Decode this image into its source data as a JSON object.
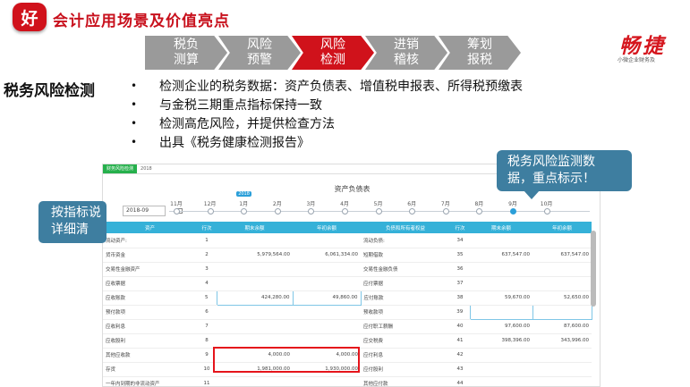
{
  "header": {
    "badge": "好",
    "title": "会计应用场景及价值亮点"
  },
  "brand": {
    "name": "畅捷",
    "subtitle": "小微企业财务及"
  },
  "steps": [
    {
      "label": "税负\n测算",
      "active": false,
      "color": "#9a9a9a"
    },
    {
      "label": "风险\n预警",
      "active": false,
      "color": "#9a9a9a"
    },
    {
      "label": "风险\n检测",
      "active": true,
      "color": "#d0121b"
    },
    {
      "label": "进销\n稽核",
      "active": false,
      "color": "#9a9a9a"
    },
    {
      "label": "筹划\n报税",
      "active": false,
      "color": "#9a9a9a"
    }
  ],
  "section": {
    "title": "税务风险检测",
    "bullets": [
      "检测企业的税务数据：资产负债表、增值税申报表、所得税预缴表",
      "与金税三期重点指标保持一致",
      "检测高危风险，并提供检查方法",
      "出具《税务健康检测报告》"
    ]
  },
  "screenshot": {
    "tab_active": "财务风险检测",
    "tab_other": "2018",
    "table_title": "资产负债表",
    "date_value": "2018-09",
    "timeline": {
      "year_tag": "2018",
      "months": [
        "11月",
        "12月",
        "1月",
        "2月",
        "3月",
        "4月",
        "5月",
        "6月",
        "7月",
        "8月",
        "9月",
        "10月"
      ],
      "selected_index": 10
    },
    "columns": [
      "资产",
      "行次",
      "期末余额",
      "年初余额",
      "负债和所有者权益",
      "行次",
      "期末余额",
      "年初余额"
    ],
    "rows": [
      [
        "流动资产:",
        "1",
        "",
        "",
        "流动负债:",
        "34",
        "",
        ""
      ],
      [
        "货币资金",
        "2",
        "5,979,564.00",
        "6,061,334.00",
        "短期借款",
        "35",
        "637,547.00",
        "637,547.00"
      ],
      [
        "交易性金融资产",
        "3",
        "",
        "",
        "交易性金融负债",
        "36",
        "",
        ""
      ],
      [
        "应收票据",
        "4",
        "",
        "",
        "应付票据",
        "37",
        "",
        ""
      ],
      [
        "应收账款",
        "5",
        "424,280.00",
        "49,860.00",
        "应付账款",
        "38",
        "59,670.00",
        "52,650.00"
      ],
      [
        "预付款项",
        "6",
        "",
        "",
        "预收款项",
        "39",
        "",
        ""
      ],
      [
        "应收利息",
        "7",
        "",
        "",
        "应付职工薪酬",
        "40",
        "97,600.00",
        "87,600.00"
      ],
      [
        "应收股利",
        "8",
        "",
        "",
        "应交税费",
        "41",
        "398,396.00",
        "343,996.00"
      ],
      [
        "其他应收款",
        "9",
        "4,000.00",
        "4,000.00",
        "应付利息",
        "42",
        "",
        ""
      ],
      [
        "存货",
        "10",
        "1,981,000.00",
        "1,930,000.00",
        "应付股利",
        "43",
        "",
        ""
      ],
      [
        "一年内到期的非流动资产",
        "11",
        "",
        "",
        "其他应付款",
        "44",
        "",
        ""
      ]
    ]
  },
  "callouts": {
    "left": "按指标说\n详细清",
    "right": "税务风险监测数\n据，重点标示！"
  },
  "colors": {
    "brand_red": "#d0121b",
    "callout_blue": "#3e7ea0",
    "table_header": "#35b1d8",
    "step_gray": "#9a9a9a"
  }
}
